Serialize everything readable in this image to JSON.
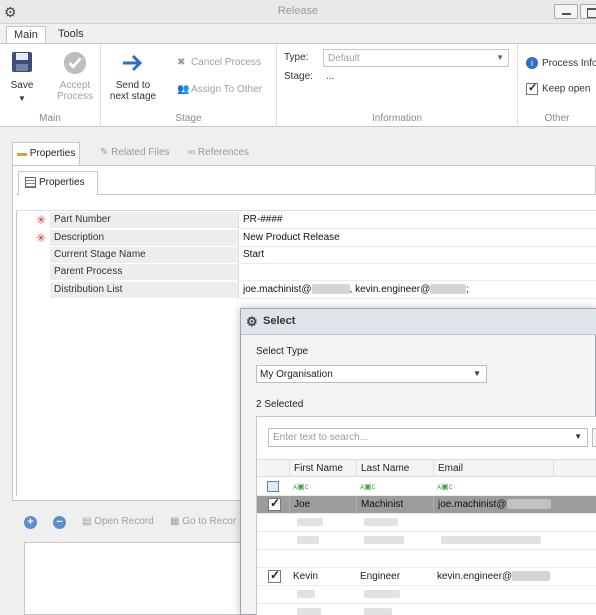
{
  "window": {
    "title": "Release"
  },
  "ribbon": {
    "tabs": [
      "Main",
      "Tools"
    ],
    "groups": {
      "main": {
        "label": "Main",
        "save": "Save",
        "accept": "Accept Process"
      },
      "stage": {
        "label": "Stage",
        "send": "Send to next stage",
        "cancel": "Cancel Process",
        "assign": "Assign To Other"
      },
      "information": {
        "label": "Information",
        "type_label": "Type:",
        "type_value": "Default",
        "stage_label": "Stage:",
        "stage_value": "..."
      },
      "other": {
        "label": "Other",
        "process_info": "Process Info",
        "keep_open": "Keep open"
      }
    }
  },
  "doc_tabs": [
    "Properties",
    "Related Files",
    "References"
  ],
  "inner_tab": "Properties",
  "properties": [
    {
      "name": "Part Number",
      "value": "PR-####",
      "required": true
    },
    {
      "name": "Description",
      "value": "New Product Release",
      "required": true
    },
    {
      "name": "Current Stage Name",
      "value": "Start",
      "required": false
    },
    {
      "name": "Parent Process",
      "value": "",
      "required": false
    },
    {
      "name": "Distribution List",
      "value": "",
      "required": false
    }
  ],
  "distribution": {
    "part1": "joe.machinist@",
    "part2": ", kevin.engineer@",
    "part3": ";"
  },
  "bottom_toolbar": {
    "open_record": "Open Record",
    "go_to_record": "Go to Recor"
  },
  "dialog": {
    "title": "Select",
    "select_type_label": "Select Type",
    "select_type_value": "My Organisation",
    "selected_count": "2 Selected",
    "search_placeholder": "Enter text to search...",
    "columns": [
      "First Name",
      "Last Name",
      "Email"
    ],
    "filter_glyph": "ᴀ▣ᴄ",
    "rows": [
      {
        "first": "Joe",
        "last": "Machinist",
        "email": "joe.machinist@",
        "checked": true,
        "selected": true
      },
      {
        "first": "Kevin",
        "last": "Engineer",
        "email": "kevin.engineer@",
        "checked": true,
        "selected": false
      }
    ]
  },
  "colors": {
    "required_star": "#dd3333",
    "accent_blue": "#2d6fc2"
  }
}
